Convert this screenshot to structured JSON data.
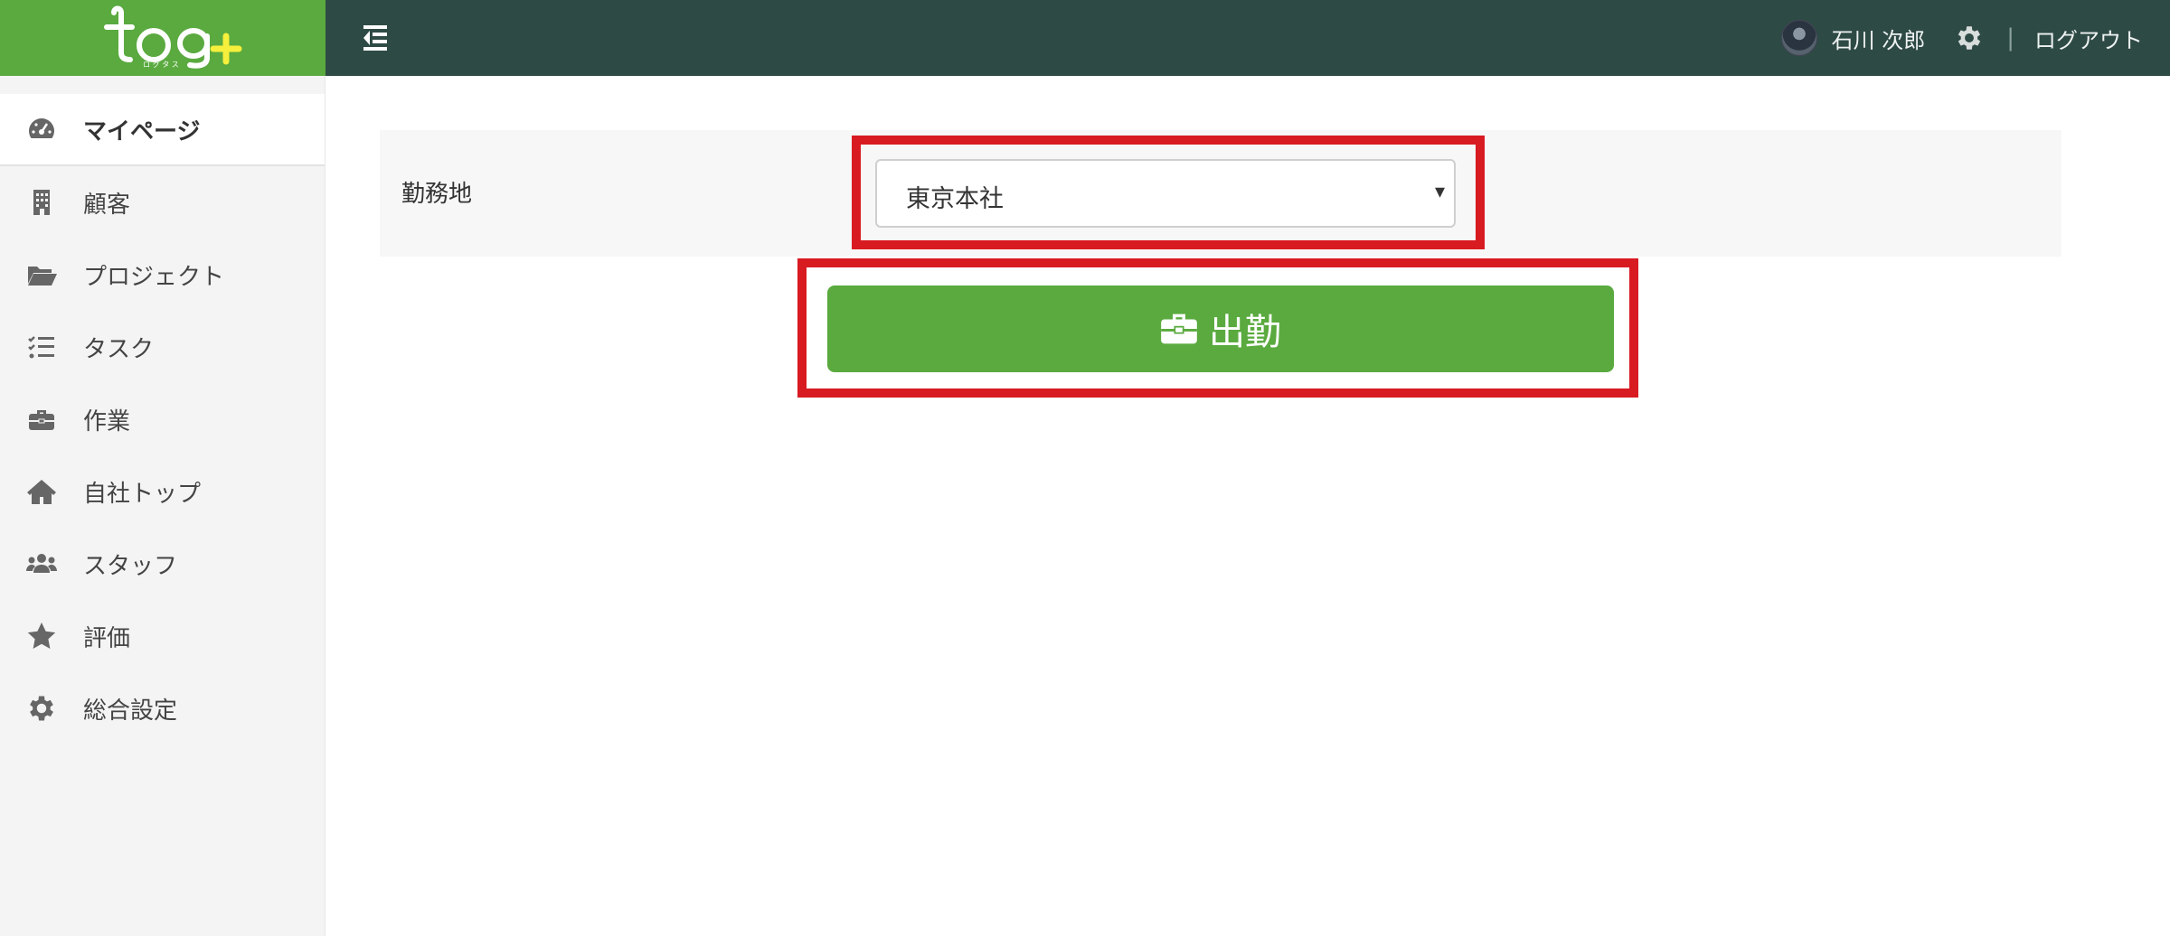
{
  "header": {
    "logo": {
      "text": "log+",
      "subtext": "ロ グ タ ス"
    },
    "user_name": "石川 次郎",
    "logout_label": "ログアウト",
    "separator": "|"
  },
  "sidebar": {
    "items": [
      {
        "label": "マイページ",
        "icon": "dashboard-icon",
        "active": true
      },
      {
        "label": "顧客",
        "icon": "building-icon"
      },
      {
        "label": "プロジェクト",
        "icon": "folder-open-icon"
      },
      {
        "label": "タスク",
        "icon": "tasks-icon"
      },
      {
        "label": "作業",
        "icon": "briefcase-icon"
      },
      {
        "label": "自社トップ",
        "icon": "home-icon"
      },
      {
        "label": "スタッフ",
        "icon": "users-icon"
      },
      {
        "label": "評価",
        "icon": "star-icon"
      },
      {
        "label": "総合設定",
        "icon": "gear-icon"
      }
    ]
  },
  "form": {
    "workplace_label": "勤務地",
    "workplace_selected": "東京本社",
    "clock_in_label": "出勤"
  },
  "colors": {
    "brand_green": "#5aaa3f",
    "topbar": "#2e4a45",
    "highlight_red": "#d81a21",
    "sidebar_bg": "#f4f4f4"
  }
}
